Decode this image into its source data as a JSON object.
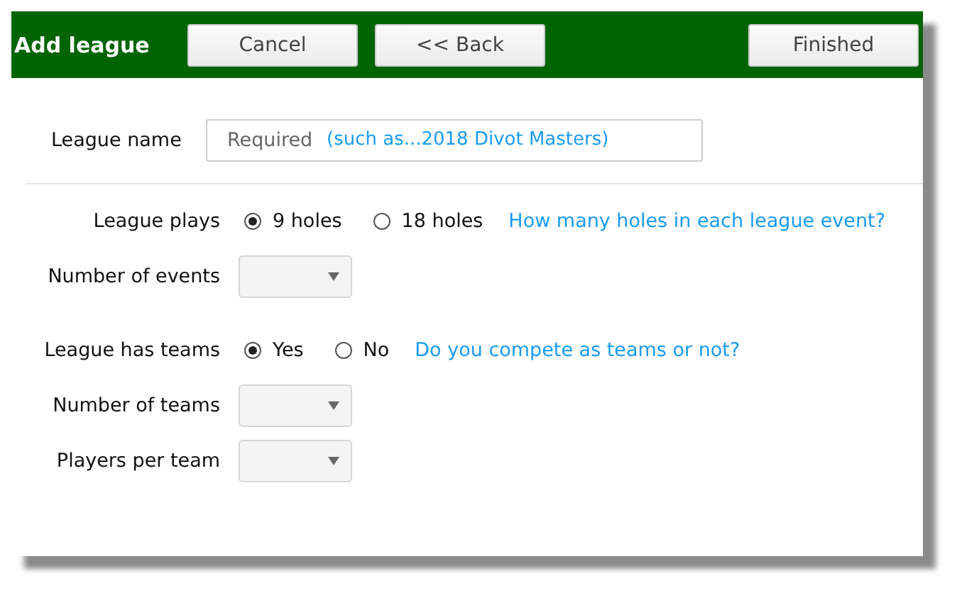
{
  "header": {
    "title": "Add league",
    "left_buttons": [
      "Cancel",
      "<< Back"
    ],
    "right_buttons": [
      "Finished"
    ]
  },
  "league_name": {
    "label": "League name",
    "placeholder": "Required",
    "hint": "(such as...2018 Divot Masters)"
  },
  "groups": [
    [
      {
        "kind": "radio",
        "label": "League plays",
        "options": [
          {
            "label": "9 holes",
            "selected": true
          },
          {
            "label": "18 holes",
            "selected": false
          }
        ],
        "hint": "How many holes in each league event?"
      },
      {
        "kind": "dropdown",
        "label": "Number of events"
      }
    ],
    [
      {
        "kind": "radio",
        "label": "League has teams",
        "options": [
          {
            "label": "Yes",
            "selected": true
          },
          {
            "label": "No",
            "selected": false
          }
        ],
        "hint": "Do you compete as teams or not?"
      },
      {
        "kind": "dropdown",
        "label": "Number of teams"
      },
      {
        "kind": "dropdown",
        "label": "Players per team"
      }
    ]
  ]
}
